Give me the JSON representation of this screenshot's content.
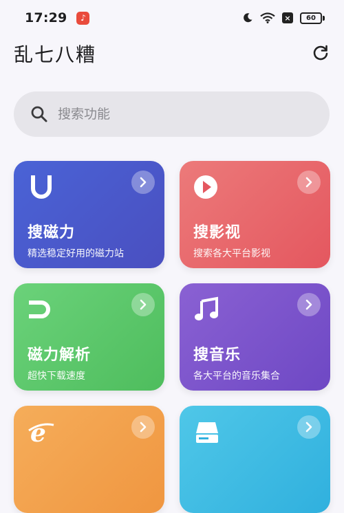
{
  "status_bar": {
    "time": "17:29",
    "battery": "60"
  },
  "header": {
    "title": "乱七八糟"
  },
  "search": {
    "placeholder": "搜索功能"
  },
  "cards": [
    {
      "title": "搜磁力",
      "subtitle": "精选稳定好用的磁力站",
      "icon": "magnet-u-icon",
      "color": "#4a58cc"
    },
    {
      "title": "搜影视",
      "subtitle": "搜索各大平台影视",
      "icon": "play-circle-icon",
      "color": "#e8646a"
    },
    {
      "title": "磁力解析",
      "subtitle": "超快下载速度",
      "icon": "magnet-icon",
      "color": "#5cc86b"
    },
    {
      "title": "搜音乐",
      "subtitle": "各大平台的音乐集合",
      "icon": "music-note-icon",
      "color": "#7b52c9"
    },
    {
      "title": "",
      "subtitle": "",
      "icon": "browser-e-icon",
      "color": "#f3a24d"
    },
    {
      "title": "",
      "subtitle": "",
      "icon": "drive-icon",
      "color": "#3fbce3"
    }
  ]
}
